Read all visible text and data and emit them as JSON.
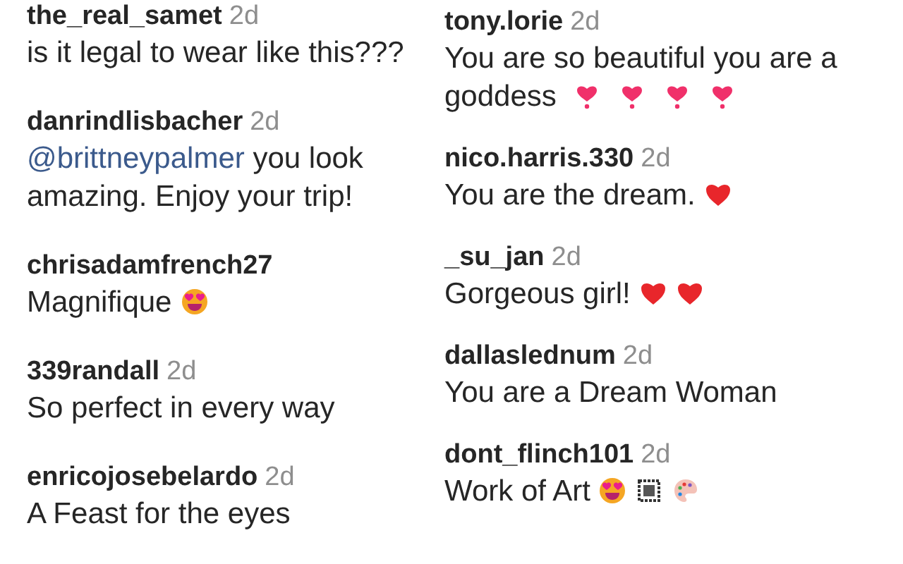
{
  "columns": [
    [
      {
        "user": "the_real_samet",
        "time": "2d",
        "body": [
          {
            "kind": "text",
            "text": "is it legal to wear like this???"
          }
        ]
      },
      {
        "user": "danrindlisbacher",
        "time": "2d",
        "body": [
          {
            "kind": "mention",
            "text": "@brittneypalmer"
          },
          {
            "kind": "text",
            "text": " you look amazing. Enjoy your trip!"
          }
        ]
      },
      {
        "user": "chrisadamfrench27",
        "body": [
          {
            "kind": "text",
            "text": "Magnifique"
          }
        ],
        "emoji": [
          {
            "kind": "heart-eyes"
          }
        ]
      },
      {
        "user": "339randall",
        "time": "2d",
        "body": [
          {
            "kind": "text",
            "text": "So perfect in every way"
          }
        ]
      },
      {
        "user": "enricojosebelardo",
        "time": "2d",
        "body": [
          {
            "kind": "text",
            "text": "A Feast for the eyes"
          }
        ]
      }
    ],
    [
      {
        "user": "tony.lorie",
        "time": "2d",
        "body": [
          {
            "kind": "text",
            "text": "You are so beautiful you are a goddess"
          }
        ],
        "emoji": [
          {
            "kind": "heart-exclamation"
          },
          {
            "kind": "heart-exclamation"
          },
          {
            "kind": "heart-exclamation"
          },
          {
            "kind": "heart-exclamation"
          }
        ]
      },
      {
        "user": "nico.harris.330",
        "time": "2d",
        "body": [
          {
            "kind": "text",
            "text": "You are the dream."
          }
        ],
        "emoji": [
          {
            "kind": "red-heart"
          }
        ]
      },
      {
        "user": "_su_jan",
        "time": "2d",
        "body": [
          {
            "kind": "text",
            "text": "Gorgeous girl!"
          }
        ],
        "emoji": [
          {
            "kind": "red-heart"
          },
          {
            "kind": "red-heart"
          }
        ]
      },
      {
        "user": "dallaslednum",
        "time": "2d",
        "body": [
          {
            "kind": "text",
            "text": "You are a Dream Woman"
          }
        ]
      },
      {
        "user": "dont_flinch101",
        "time": "2d",
        "body": [
          {
            "kind": "text",
            "text": "Work of Art"
          }
        ],
        "emoji": [
          {
            "kind": "heart-eyes"
          },
          {
            "kind": "framed-picture"
          },
          {
            "kind": "palette"
          }
        ]
      }
    ]
  ]
}
